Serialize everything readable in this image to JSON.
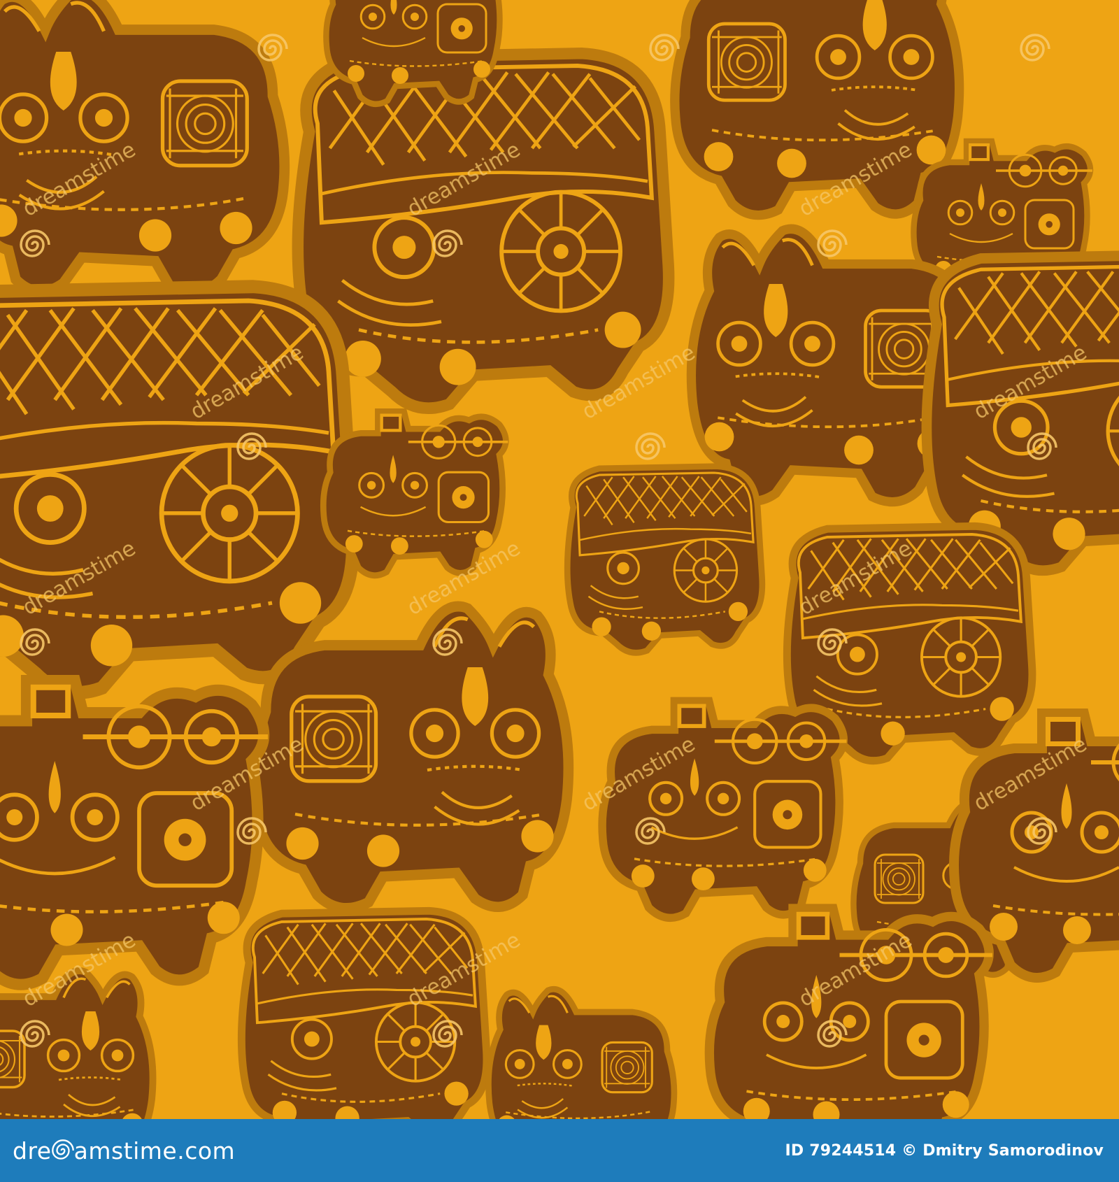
{
  "image": {
    "description_colors": {
      "background": "#eea414",
      "figure_fill": "#7c4310",
      "figure_lines": "#eea414",
      "figure_outline": "#bd7b0e",
      "watermark_swirl": "#f6c768",
      "footer_bar": "#1e7cbb",
      "footer_text": "#ffffff"
    }
  },
  "footer": {
    "logo_prefix": "dre",
    "logo_suffix": "amstime.com",
    "credit": "ID 79244514 © Dmitry Samorodinov"
  },
  "watermark": {
    "text": "dreamstime"
  }
}
